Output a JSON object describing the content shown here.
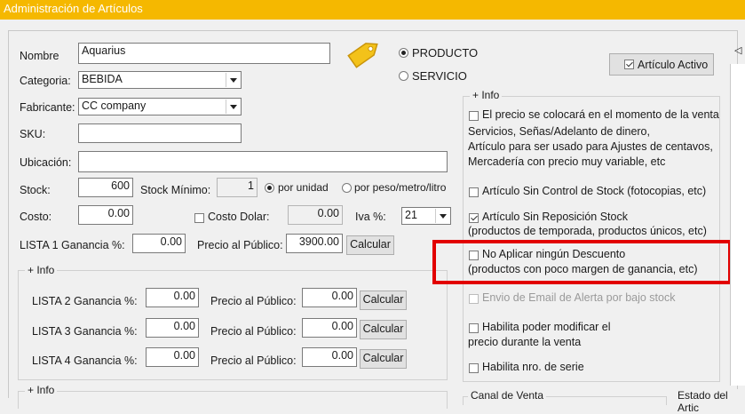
{
  "window": {
    "title": "Administración de Artículos"
  },
  "form": {
    "nombre_label": "Nombre",
    "nombre_value": "Aquarius",
    "categoria_label": "Categoria:",
    "categoria_value": "BEBIDA",
    "fabricante_label": "Fabricante:",
    "fabricante_value": "CC company",
    "sku_label": "SKU:",
    "sku_value": "",
    "ubicacion_label": "Ubicación:",
    "ubicacion_value": "",
    "stock_label": "Stock:",
    "stock_value": "600",
    "stock_minimo_label": "Stock Mínimo:",
    "stock_minimo_value": "1",
    "por_unidad_label": "por unidad",
    "por_peso_label": "por peso/metro/litro",
    "costo_label": "Costo:",
    "costo_value": "0.00",
    "costo_dolar_label": "Costo Dolar:",
    "costo_dolar_value": "0.00",
    "iva_label": "Iva %:",
    "iva_value": "21",
    "lista1_label": "LISTA 1 Ganancia %:",
    "lista1_value": "0.00",
    "precio_publico_label": "Precio al Público:",
    "precio1_value": "3900.00",
    "calcular_label": "Calcular"
  },
  "tipo": {
    "producto_label": "PRODUCTO",
    "servicio_label": "SERVICIO"
  },
  "activo_label": "Artículo Activo",
  "info_group": {
    "title": "+ Info",
    "rows": [
      {
        "label": "LISTA 2 Ganancia %:",
        "ganancia": "0.00",
        "precio_label": "Precio al Público:",
        "precio": "0.00",
        "btn": "Calcular"
      },
      {
        "label": "LISTA 3 Ganancia %:",
        "ganancia": "0.00",
        "precio_label": "Precio al Público:",
        "precio": "0.00",
        "btn": "Calcular"
      },
      {
        "label": "LISTA 4 Ganancia %:",
        "ganancia": "0.00",
        "precio_label": "Precio al Público:",
        "precio": "0.00",
        "btn": "Calcular"
      }
    ]
  },
  "info_group2": {
    "title": "+ Info"
  },
  "right_info": {
    "title": "+ Info",
    "precio_momento": "El precio se colocará en el momento de la venta",
    "precio_momento_desc1": "Servicios, Señas/Adelanto de dinero,",
    "precio_momento_desc2": "Artículo para ser usado para Ajustes de centavos,",
    "precio_momento_desc3": "Mercadería con precio muy variable, etc",
    "sin_control_stock": "Artículo Sin Control de Stock (fotocopias, etc)",
    "sin_reposicion": "Artículo Sin Reposición Stock",
    "sin_reposicion_desc": "(productos de temporada, productos únicos, etc)",
    "no_descuento": "No Aplicar ningún Descuento",
    "no_descuento_desc": "(productos con poco margen de ganancia, etc)",
    "email_alerta": "Envio de Email de Alerta por bajo stock",
    "modificar_precio": "Habilita poder modificar el",
    "modificar_precio_desc": "precio durante la venta",
    "nro_serie": "Habilita nro. de serie"
  },
  "canal_venta": "Canal de Venta",
  "estado_articulo": "Estado del Artic",
  "colors": {
    "titlebar": "#f5b800",
    "highlight": "#e20000"
  }
}
